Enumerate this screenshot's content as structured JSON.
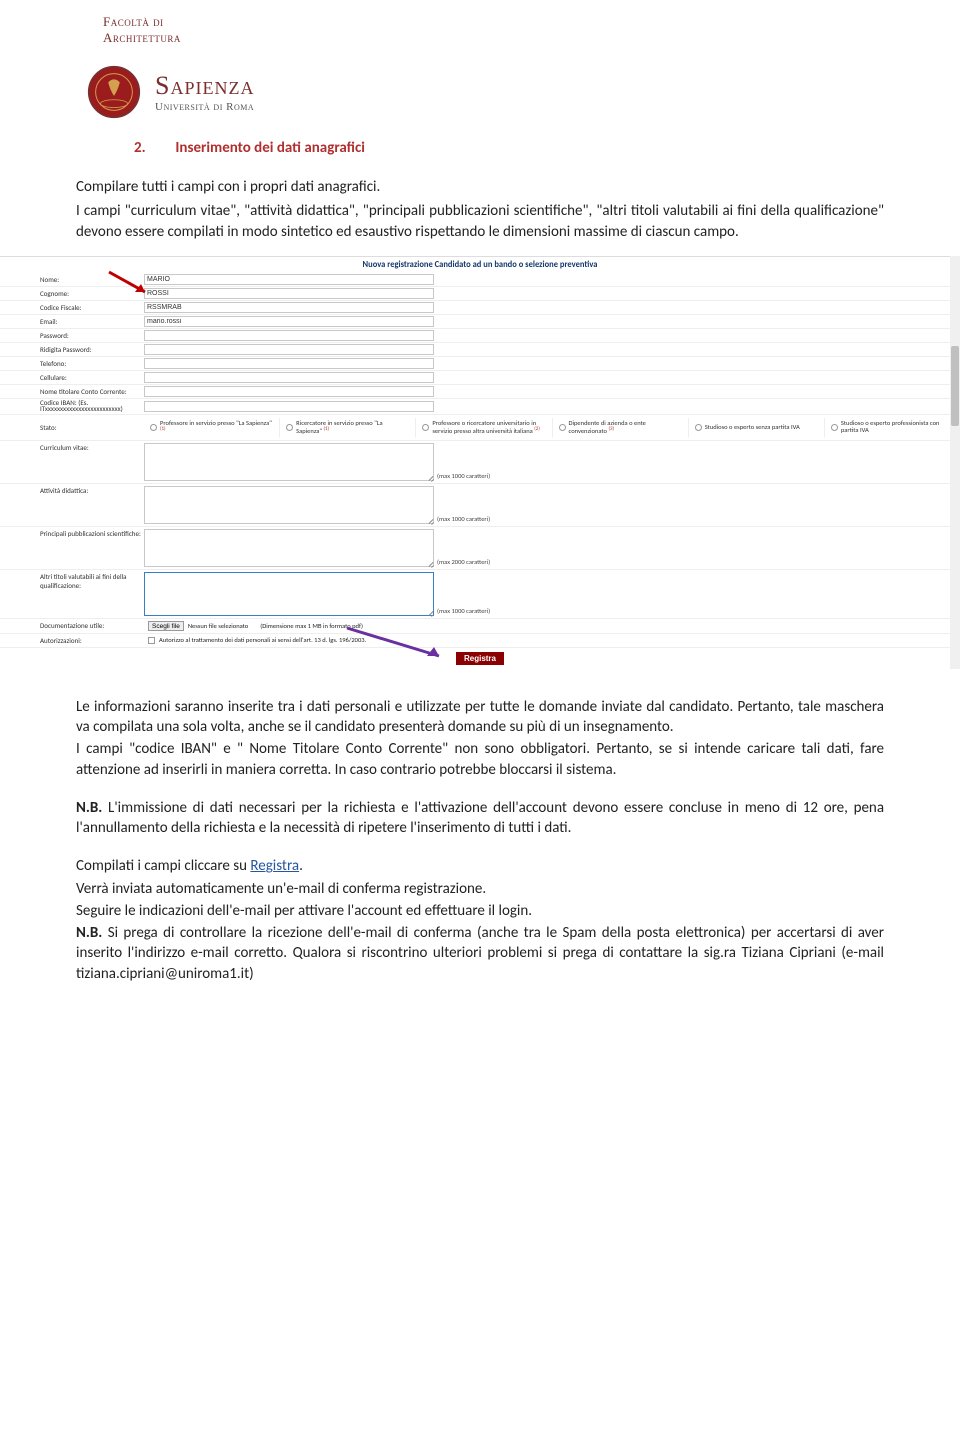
{
  "header": {
    "faculty_line1": "Facoltà di",
    "faculty_line2": "Architettura",
    "logo_name": "Sapienza",
    "logo_sub": "Università di Roma"
  },
  "section": {
    "number": "2.",
    "title": "Inserimento dei dati anagrafici"
  },
  "intro": {
    "p1": "Compilare tutti i campi con i propri dati anagrafici.",
    "p2": "I campi \"curriculum vitae\", \"attività didattica\", \"principali pubblicazioni scientifiche\", \"altri titoli valutabili ai fini della qualificazione\" devono essere compilati in modo sintetico ed esaustivo rispettando le dimensioni massime di ciascun campo."
  },
  "form": {
    "title": "Nuova registrazione Candidato ad un bando o selezione preventiva",
    "labels": {
      "nome": "Nome:",
      "cognome": "Cognome:",
      "cf": "Codice Fiscale:",
      "email": "Email:",
      "password": "Password:",
      "ridigita": "Ridigita Password:",
      "telefono": "Telefono:",
      "cellulare": "Cellulare:",
      "titolare": "Nome titolare Conto Corrente:",
      "iban": "Codice IBAN: (Es. ITxxxxxxxxxxxxxxxxxxxxxxxxx)",
      "stato": "Stato:",
      "cv": "Curriculum vitae:",
      "attivita": "Attività didattica:",
      "pubb": "Principali pubblicazioni scientifiche:",
      "altri": "Altri titoli valutabili ai fini della qualificazione:",
      "doc": "Documentazione utile:",
      "auth": "Autorizzazioni:"
    },
    "values": {
      "nome": "MARIO",
      "cognome": "ROSSI",
      "cf": "RSSMRAB",
      "email": "mario.rossi"
    },
    "stato_opts": [
      "Professore in servizio presso \"La Sapienza\"",
      "Ricercatore in servizio presso \"La Sapienza\"",
      "Professore o ricercatore universitario in servizio presso altra università italiana",
      "Dipendente di azienda o ente convenzionato",
      "Studioso o esperto senza partita IVA",
      "Studioso o esperto professionista con partita IVA"
    ],
    "hints": {
      "h1000": "(max 1000 caratteri)",
      "h2000": "(max 2000 caratteri)"
    },
    "doc_btn": "Scegli file",
    "doc_nofile": "Nessun file selezionato",
    "doc_hint": "(Dimensione max 1 MB in formato pdf)",
    "auth_text": "Autorizzo al trattamento dei dati personali ai sensi dell'art. 13 d. lgs. 196/2003.",
    "registra": "Registra"
  },
  "after": {
    "p1": "Le informazioni saranno inserite tra i dati personali e utilizzate per tutte le domande inviate dal candidato. Pertanto, tale maschera va compilata una sola volta, anche se il candidato presenterà domande su più di un insegnamento.",
    "p2a": "I campi \"codice IBAN\" e \" Nome Titolare Conto Corrente\" non sono obbligatori.  Pertanto, se si intende caricare tali dati, fare attenzione ad inserirli in maniera corretta. In caso contrario potrebbe bloccarsi il sistema.",
    "p3_label": "N.B.",
    "p3": " L'immissione di dati necessari per la richiesta e l'attivazione dell'account devono essere concluse in meno di 12 ore, pena l'annullamento della richiesta e la necessità di ripetere l'inserimento di tutti i dati.",
    "p4a": "Compilati i campi cliccare su ",
    "p4_link": "Registra",
    "p4b": ".",
    "p5": "Verrà inviata automaticamente  un'e-mail  di  conferma  registrazione.",
    "p6": "Seguire le indicazioni dell'e-mail per attivare l'account ed effettuare il login.",
    "p7_label": "N.B.",
    "p7": " Si prega di controllare la ricezione dell'e-mail di conferma (anche tra le Spam della posta elettronica) per accertarsi di aver inserito l'indirizzo e-mail corretto. Qualora si riscontrino ulteriori problemi si prega di contattare la sig.ra Tiziana Cipriani (e-mail tiziana.cipriani@uniroma1.it)"
  }
}
